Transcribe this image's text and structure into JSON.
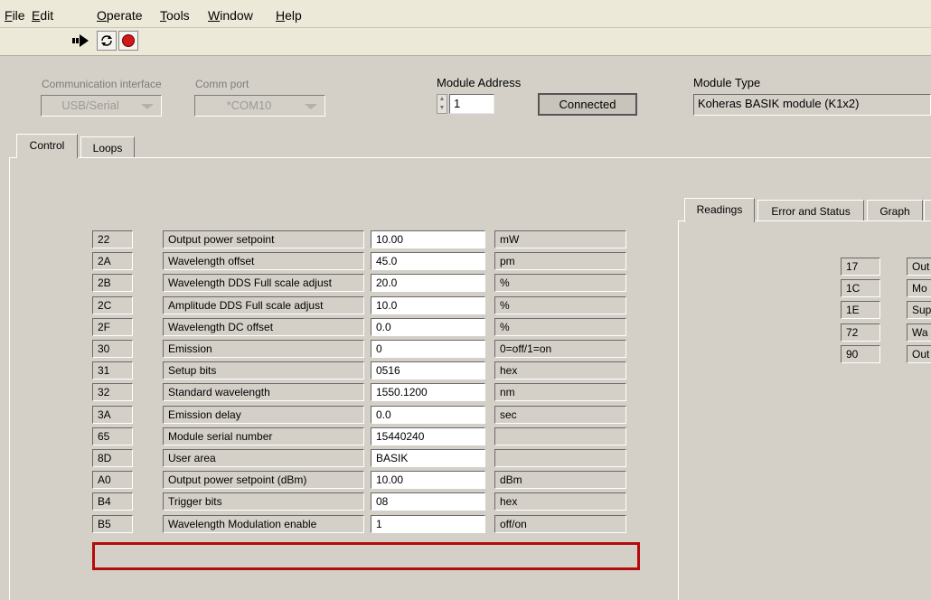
{
  "menu": [
    {
      "label": "File",
      "ul": "F",
      "rest": "ile"
    },
    {
      "label": "Edit",
      "ul": "E",
      "rest": "dit"
    },
    {
      "label": "Operate",
      "ul": "O",
      "rest": "perate"
    },
    {
      "label": "Tools",
      "ul": "T",
      "rest": "ools"
    },
    {
      "label": "Window",
      "ul": "W",
      "rest": "indow"
    },
    {
      "label": "Help",
      "ul": "H",
      "rest": "elp"
    }
  ],
  "toolbar": {
    "run_icon": "run-arrow-icon",
    "run_continuous_icon": "run-continuously-icon",
    "abort_icon": "abort-stop-icon"
  },
  "comm": {
    "interface_label": "Communication interface",
    "interface_value": "USB/Serial",
    "port_label": "Comm port",
    "port_value": "*COM10"
  },
  "module_address": {
    "label": "Module Address",
    "value": "1"
  },
  "connected_label": "Connected",
  "module_type": {
    "label": "Module Type",
    "value": "Koheras BASIK module (K1x2)"
  },
  "main_tabs": [
    "Control",
    "Loops"
  ],
  "right_tabs": [
    "Readings",
    "Error and Status",
    "Graph"
  ],
  "control_table": [
    {
      "reg": "22",
      "name": "Output power setpoint",
      "value": "10.00",
      "unit": "mW"
    },
    {
      "reg": "2A",
      "name": "Wavelength offset",
      "value": "45.0",
      "unit": "pm"
    },
    {
      "reg": "2B",
      "name": "Wavelength DDS Full scale adjust",
      "value": "20.0",
      "unit": "%"
    },
    {
      "reg": "2C",
      "name": "Amplitude DDS Full scale adjust",
      "value": "10.0",
      "unit": "%"
    },
    {
      "reg": "2F",
      "name": "Wavelength DC offset",
      "value": "0.0",
      "unit": "%"
    },
    {
      "reg": "30",
      "name": "Emission",
      "value": "0",
      "unit": "0=off/1=on"
    },
    {
      "reg": "31",
      "name": "Setup bits",
      "value": "0516",
      "unit": "hex"
    },
    {
      "reg": "32",
      "name": "Standard wavelength",
      "value": "1550.1200",
      "unit": "nm"
    },
    {
      "reg": "3A",
      "name": "Emission delay",
      "value": "0.0",
      "unit": "sec"
    },
    {
      "reg": "65",
      "name": "Module serial number",
      "value": "15440240",
      "unit": ""
    },
    {
      "reg": "8D",
      "name": "User area",
      "value": "BASIK",
      "unit": ""
    },
    {
      "reg": "A0",
      "name": "Output power setpoint (dBm)",
      "value": "10.00",
      "unit": "dBm"
    },
    {
      "reg": "B4",
      "name": "Trigger bits",
      "value": "08",
      "unit": "hex"
    },
    {
      "reg": "B5",
      "name": "Wavelength Modulation enable",
      "value": "1",
      "unit": "off/on"
    }
  ],
  "readings_table": [
    {
      "reg": "17",
      "name": "Out"
    },
    {
      "reg": "1C",
      "name": "Mo"
    },
    {
      "reg": "1E",
      "name": "Sup"
    },
    {
      "reg": "72",
      "name": "Wa"
    },
    {
      "reg": "90",
      "name": "Out"
    }
  ],
  "highlight_color": "#b30c0c"
}
